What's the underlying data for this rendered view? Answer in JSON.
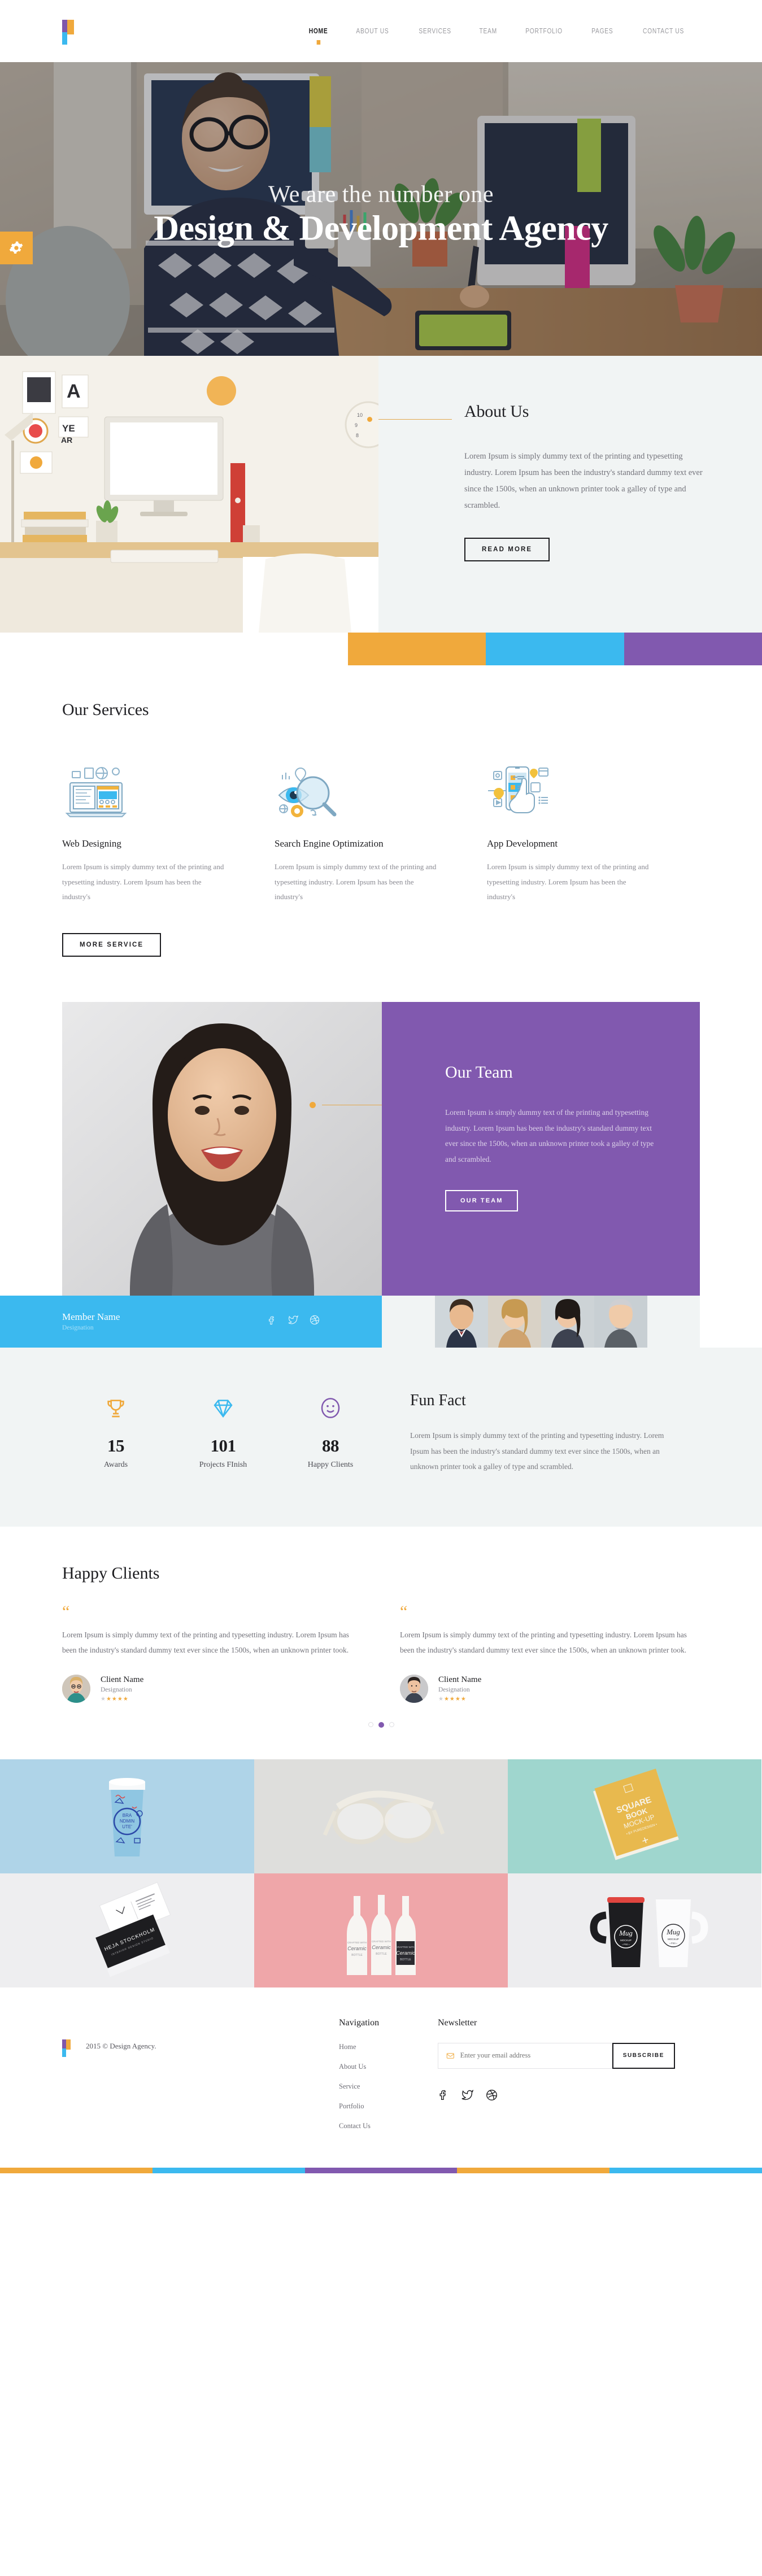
{
  "header": {
    "logo_name": "design-agency-logo",
    "nav": [
      {
        "label": "HOME",
        "active": true
      },
      {
        "label": "ABOUT US",
        "active": false
      },
      {
        "label": "SERVICES",
        "active": false
      },
      {
        "label": "TEAM",
        "active": false
      },
      {
        "label": "PORTFOLIO",
        "active": false
      },
      {
        "label": "PAGES",
        "active": false
      },
      {
        "label": "CONTACT US",
        "active": false
      }
    ]
  },
  "hero": {
    "subtitle": "We are the number one",
    "title": "Design & Development Agency",
    "badge_icon": "gear-icon"
  },
  "about": {
    "title": "About Us",
    "body": "Lorem Ipsum is simply dummy text of the printing and typesetting industry. Lorem Ipsum has been the industry's standard dummy text ever since the 1500s, when an unknown printer took a galley of type and scrambled.",
    "button": "READ MORE"
  },
  "colorbars": {
    "orange": "#F0A93C",
    "blue": "#3BB9EF",
    "purple": "#8159AF"
  },
  "services": {
    "title": "Our Services",
    "button": "MORE SERVICE",
    "items": [
      {
        "icon": "laptop-web-design-icon",
        "name": "Web Designing",
        "body": "Lorem Ipsum is simply dummy text of the printing and typesetting industry. Lorem Ipsum has been the industry's"
      },
      {
        "icon": "magnifier-eye-seo-icon",
        "name": "Search Engine Optimization",
        "body": "Lorem Ipsum is simply dummy text of the printing and typesetting industry. Lorem Ipsum has been the industry's"
      },
      {
        "icon": "mobile-app-hand-icon",
        "name": "App Development",
        "body": "Lorem Ipsum is simply dummy text of the printing and typesetting industry. Lorem Ipsum has been the industry's"
      }
    ]
  },
  "team": {
    "title": "Our Team",
    "body": "Lorem Ipsum is simply dummy text of the printing and typesetting industry. Lorem Ipsum has been the industry's standard dummy text ever since the 1500s, when an unknown printer took a galley of type and scrambled.",
    "button": "OUR TEAM",
    "member_name": "Member Name",
    "member_designation": "Designation",
    "social": [
      "facebook-icon",
      "twitter-icon",
      "dribbble-icon"
    ]
  },
  "funfact": {
    "title": "Fun Fact",
    "body": "Lorem Ipsum is simply dummy text of the printing and typesetting industry. Lorem Ipsum has been the industry's standard dummy text ever since the 1500s, when an unknown printer took a galley of type and scrambled.",
    "counters": [
      {
        "icon": "trophy-icon",
        "value": "15",
        "label": "Awards",
        "color": "#F0A93C"
      },
      {
        "icon": "diamond-icon",
        "value": "101",
        "label": "Projects FInish",
        "color": "#3BB9EF"
      },
      {
        "icon": "smiley-icon",
        "value": "88",
        "label": "Happy Clients",
        "color": "#8159AF"
      }
    ]
  },
  "testimonials": {
    "title": "Happy Clients",
    "items": [
      {
        "quote_icon": "quote-icon",
        "body": "Lorem Ipsum is simply dummy text of the printing and typesetting industry. Lorem Ipsum has been the industry's standard dummy text ever since the 1500s, when an unknown printer took.",
        "name": "Client Name",
        "designation": "Designation",
        "rating": 4
      },
      {
        "quote_icon": "quote-icon",
        "body": "Lorem Ipsum is simply dummy text of the printing and typesetting industry. Lorem Ipsum has been the industry's standard dummy text ever since the 1500s, when an unknown printer took.",
        "name": "Client Name",
        "designation": "Designation",
        "rating": 4
      }
    ],
    "pagination": {
      "count": 3,
      "active_index": 1
    }
  },
  "portfolio": {
    "items": [
      {
        "name": "coffee-cup-mockup",
        "caption": "BRA NDMIN UTE'",
        "bg": "#AFD4E8"
      },
      {
        "name": "eyeglasses-mockup",
        "caption": "",
        "bg": "#DEDEDC"
      },
      {
        "name": "square-book-mockup",
        "caption": "SQUARE BOOK MOCK-UP",
        "bg": "#9FD6CE"
      },
      {
        "name": "business-card-mockup",
        "caption": "HEJA STOCKHOLM",
        "bg": "#EEEEF0"
      },
      {
        "name": "ceramic-bottles-mockup",
        "caption": "Ceramic BOTTLE",
        "bg": "#EFA6A9"
      },
      {
        "name": "mug-mockup",
        "caption": "Mug MOCKUP PSD",
        "bg": "#EDEDEF"
      }
    ]
  },
  "footer": {
    "copyright": "2015 © Design Agency.",
    "nav_head": "Navigation",
    "nav_links": [
      "Home",
      "About Us",
      "Service",
      "Portfolio",
      "Contact Us"
    ],
    "news_head": "Newsletter",
    "news_placeholder": "Enter your email address",
    "news_button": "SUBSCRIBE",
    "news_icon": "envelope-icon",
    "social": [
      "facebook-icon",
      "twitter-icon",
      "dribbble-icon"
    ],
    "bottom_bars": [
      "#F0A93C",
      "#3BB9EF",
      "#8159AF",
      "#F0A93C",
      "#3BB9EF"
    ]
  }
}
